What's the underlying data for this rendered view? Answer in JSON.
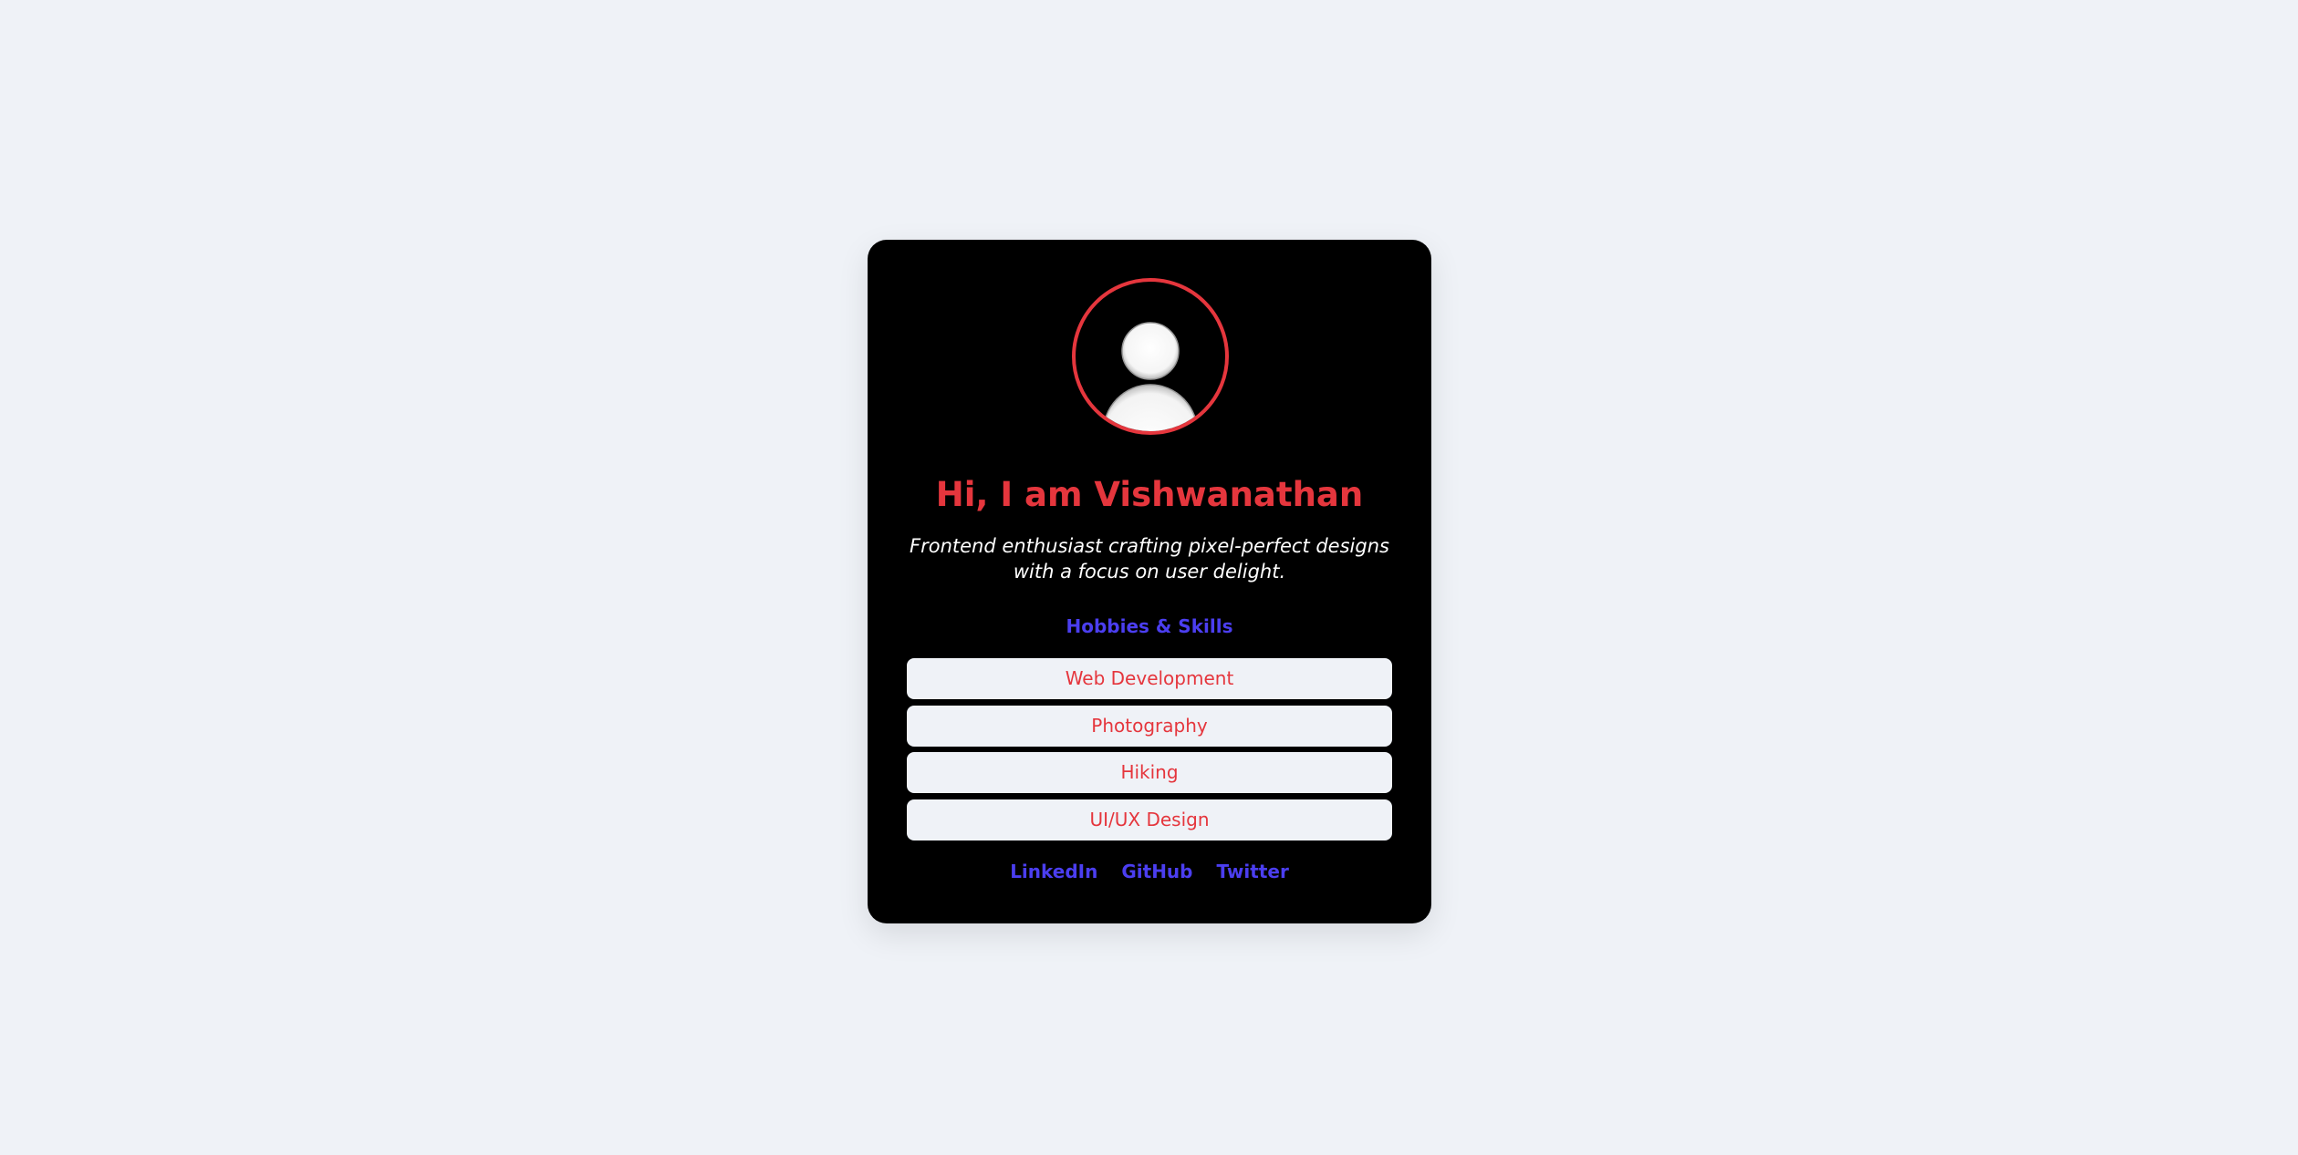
{
  "profile": {
    "avatar_icon": "user-silhouette-icon",
    "heading": "Hi, I am Vishwanathan",
    "bio": "Frontend enthusiast crafting pixel-perfect designs with a focus on user delight."
  },
  "skills": {
    "title": "Hobbies & Skills",
    "items": [
      "Web Development",
      "Photography",
      "Hiking",
      "UI/UX Design"
    ]
  },
  "links": [
    {
      "label": "LinkedIn"
    },
    {
      "label": "GitHub"
    },
    {
      "label": "Twitter"
    }
  ],
  "colors": {
    "page_background": "#eff2f7",
    "card_background": "#000000",
    "accent_red": "#e5363d",
    "accent_blue": "#4b3ef0",
    "text_white": "#ffffff"
  }
}
